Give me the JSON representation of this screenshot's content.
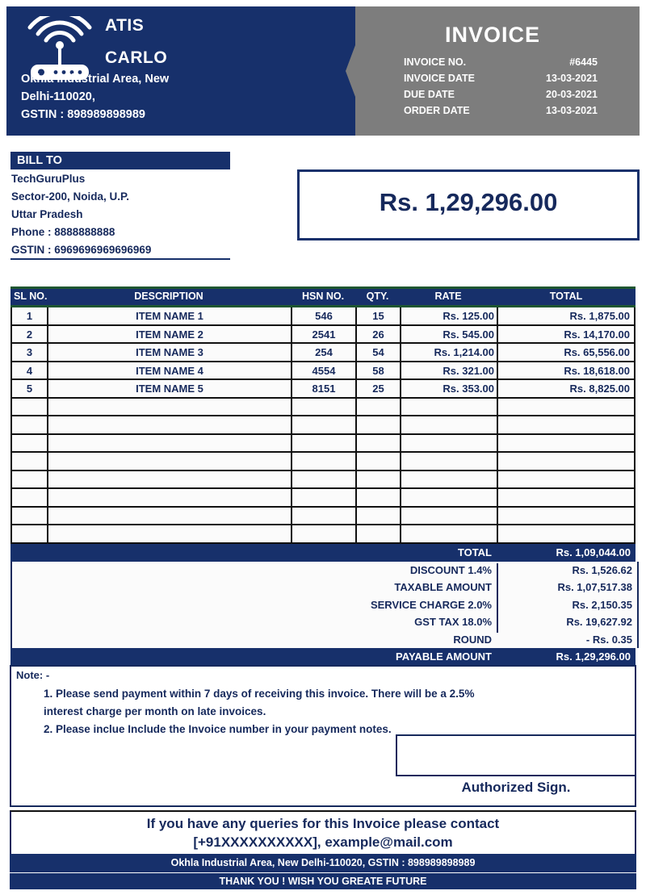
{
  "colors": {
    "navy": "#17306b",
    "navy_text": "#16295c",
    "gray_panel": "#7d7d7d",
    "green_rule": "#1e5631",
    "white": "#ffffff"
  },
  "header": {
    "logo_icon": "wifi-router-icon",
    "brand_line1": "ATIS",
    "brand_line2": "CARLO",
    "address_line1": "Okhla Industrial Area, New",
    "address_line2": "Delhi-110020,",
    "address_line3": "GSTIN : 898989898989",
    "invoice_word": "INVOICE",
    "meta": [
      {
        "label": "INVOICE NO.",
        "value": "#6445"
      },
      {
        "label": "INVOICE  DATE",
        "value": "13-03-2021"
      },
      {
        "label": "DUE DATE",
        "value": "20-03-2021"
      },
      {
        "label": "ORDER DATE",
        "value": "13-03-2021"
      }
    ]
  },
  "bill_to": {
    "heading": "BILL TO",
    "lines": [
      "TechGuruPlus",
      "Sector-200, Noida, U.P.",
      "Uttar Pradesh",
      "Phone : 8888888888",
      "GSTIN : 6969696969696969"
    ]
  },
  "amount_box": {
    "value": "Rs. 1,29,296.00"
  },
  "items_table": {
    "columns": [
      "SL NO.",
      "DESCRIPTION",
      "HSN NO.",
      "QTY.",
      "RATE",
      "TOTAL"
    ],
    "rows": [
      {
        "sl": "1",
        "description": "ITEM NAME 1",
        "hsn": "546",
        "qty": "15",
        "rate": "Rs. 125.00",
        "total": "Rs. 1,875.00"
      },
      {
        "sl": "2",
        "description": "ITEM NAME 2",
        "hsn": "2541",
        "qty": "26",
        "rate": "Rs. 545.00",
        "total": "Rs. 14,170.00"
      },
      {
        "sl": "3",
        "description": "ITEM NAME 3",
        "hsn": "254",
        "qty": "54",
        "rate": "Rs. 1,214.00",
        "total": "Rs. 65,556.00"
      },
      {
        "sl": "4",
        "description": "ITEM NAME 4",
        "hsn": "4554",
        "qty": "58",
        "rate": "Rs. 321.00",
        "total": "Rs. 18,618.00"
      },
      {
        "sl": "5",
        "description": "ITEM NAME 5",
        "hsn": "8151",
        "qty": "25",
        "rate": "Rs. 353.00",
        "total": "Rs. 8,825.00"
      },
      {
        "sl": "",
        "description": "",
        "hsn": "",
        "qty": "",
        "rate": "",
        "total": ""
      },
      {
        "sl": "",
        "description": "",
        "hsn": "",
        "qty": "",
        "rate": "",
        "total": ""
      },
      {
        "sl": "",
        "description": "",
        "hsn": "",
        "qty": "",
        "rate": "",
        "total": ""
      },
      {
        "sl": "",
        "description": "",
        "hsn": "",
        "qty": "",
        "rate": "",
        "total": ""
      },
      {
        "sl": "",
        "description": "",
        "hsn": "",
        "qty": "",
        "rate": "",
        "total": ""
      },
      {
        "sl": "",
        "description": "",
        "hsn": "",
        "qty": "",
        "rate": "",
        "total": ""
      },
      {
        "sl": "",
        "description": "",
        "hsn": "",
        "qty": "",
        "rate": "",
        "total": ""
      },
      {
        "sl": "",
        "description": "",
        "hsn": "",
        "qty": "",
        "rate": "",
        "total": ""
      }
    ]
  },
  "summary": {
    "total_label": "TOTAL",
    "total_value": "Rs. 1,09,044.00",
    "rows": [
      {
        "label": "DISCOUNT 1.4%",
        "value": "Rs. 1,526.62"
      },
      {
        "label": "TAXABLE AMOUNT",
        "value": "Rs. 1,07,517.38"
      },
      {
        "label": "SERVICE CHARGE 2.0%",
        "value": "Rs. 2,150.35"
      },
      {
        "label": "GST TAX 18.0%",
        "value": "Rs. 19,627.92"
      },
      {
        "label": "ROUND",
        "value": "- Rs. 0.35"
      }
    ],
    "payable_label": "PAYABLE AMOUNT",
    "payable_value": "Rs. 1,29,296.00"
  },
  "notes": {
    "title": "Note: -",
    "lines": [
      "1. Please send payment within 7 days of receiving this invoice. There will be a 2.5%",
      "interest charge per month on late invoices.",
      "2. Please inclue Include the Invoice number in your payment notes."
    ],
    "sign_label": "Authorized Sign."
  },
  "footer": {
    "contact_line1": "If you have any queries for this Invoice  please contact",
    "contact_line2": "[+91XXXXXXXXXX], example@mail.com",
    "address": "Okhla Industrial Area, New Delhi-110020, GSTIN : 898989898989",
    "thanks": "THANK YOU ! WISH YOU GREATE FUTURE"
  }
}
